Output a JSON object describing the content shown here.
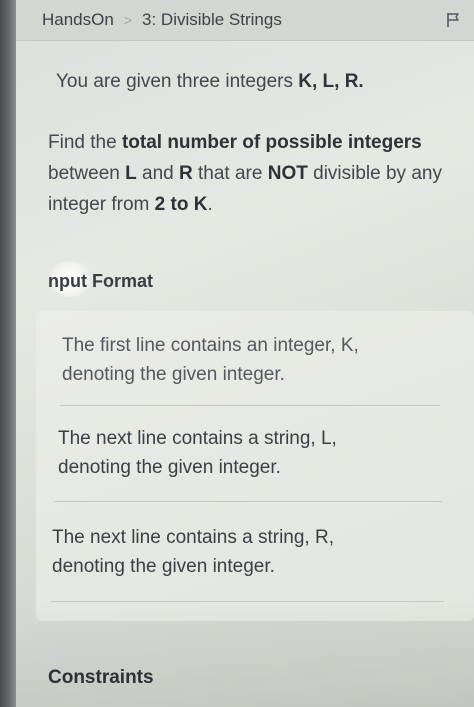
{
  "header": {
    "breadcrumb_root": "HandsOn",
    "breadcrumb_separator": ">",
    "problem_title": "3: Divisible Strings",
    "flag_icon": "flag-icon"
  },
  "statement": {
    "intro_prefix": "You are given three integers ",
    "intro_bold": "K, L, R.",
    "find_prefix": "Find the ",
    "find_bold_1": "total number of possible integers",
    "find_mid_1": " between ",
    "find_bold_L": "L",
    "find_mid_2": " and ",
    "find_bold_R": "R",
    "find_mid_3": " that are ",
    "find_bold_not": "NOT",
    "find_mid_4": " divisible by any integer from ",
    "find_bold_range": "2 to K",
    "find_end": "."
  },
  "input_format": {
    "title": "nput Format",
    "items": [
      {
        "line1": "The first line contains an integer, K,",
        "line2": "denoting the given integer."
      },
      {
        "line1": "The next line contains a string, L,",
        "line2": "denoting the given integer."
      },
      {
        "line1": "The next line contains a string, R,",
        "line2": "denoting the given integer."
      }
    ]
  },
  "constraints": {
    "title": "Constraints"
  }
}
